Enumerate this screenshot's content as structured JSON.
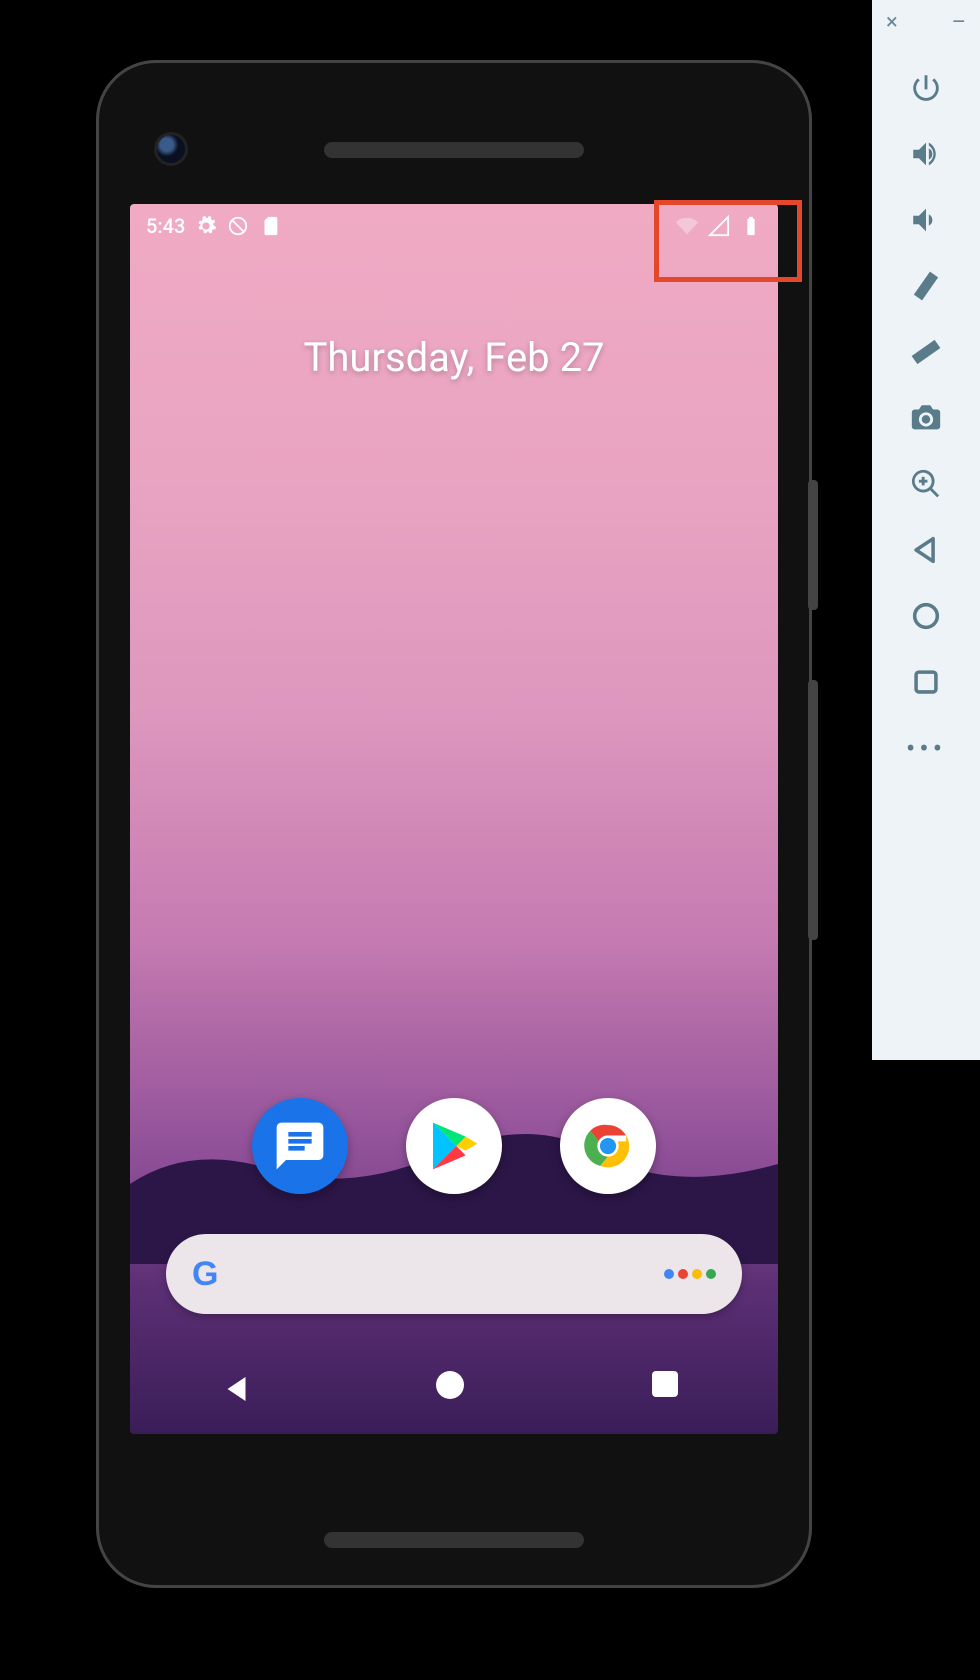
{
  "emulator_toolbar": {
    "window_close": "×",
    "window_minimize": "–",
    "buttons": [
      {
        "name": "power-button"
      },
      {
        "name": "volume-up-button"
      },
      {
        "name": "volume-down-button"
      },
      {
        "name": "rotate-left-button"
      },
      {
        "name": "rotate-right-button"
      },
      {
        "name": "screenshot-button"
      },
      {
        "name": "zoom-button"
      },
      {
        "name": "back-button"
      },
      {
        "name": "home-button"
      },
      {
        "name": "overview-button"
      },
      {
        "name": "more-button"
      }
    ]
  },
  "statusbar": {
    "time": "5:43",
    "icons_left": [
      "gear-icon",
      "do-not-disturb-icon",
      "sd-card-icon"
    ],
    "icons_right": [
      "wifi-icon",
      "cellular-icon",
      "battery-icon"
    ]
  },
  "home": {
    "date": "Thursday, Feb 27",
    "dock": [
      {
        "name": "messages-app",
        "label": "Messages"
      },
      {
        "name": "play-store-app",
        "label": "Play Store"
      },
      {
        "name": "chrome-app",
        "label": "Chrome"
      }
    ],
    "search_placeholder": ""
  },
  "navbar": {
    "back": "Back",
    "home": "Home",
    "overview": "Overview"
  },
  "annotation": {
    "highlight_target": "status-bar-right-icons"
  }
}
